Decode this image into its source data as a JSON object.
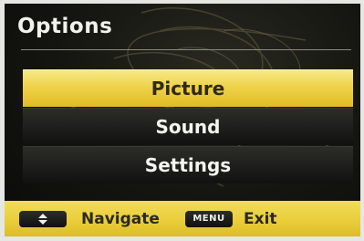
{
  "header": {
    "title": "Options"
  },
  "menu": {
    "items": [
      {
        "label": "Picture",
        "selected": true
      },
      {
        "label": "Sound",
        "selected": false
      },
      {
        "label": "Settings",
        "selected": false
      }
    ]
  },
  "footer": {
    "navigate_key_icon": "up-down-arrows-icon",
    "navigate_label": "Navigate",
    "menu_key_label": "MENU",
    "exit_label": "Exit"
  },
  "colors": {
    "accent_yellow": "#efd24a",
    "background_dark": "#141410",
    "text_light": "#f4f4ee"
  }
}
